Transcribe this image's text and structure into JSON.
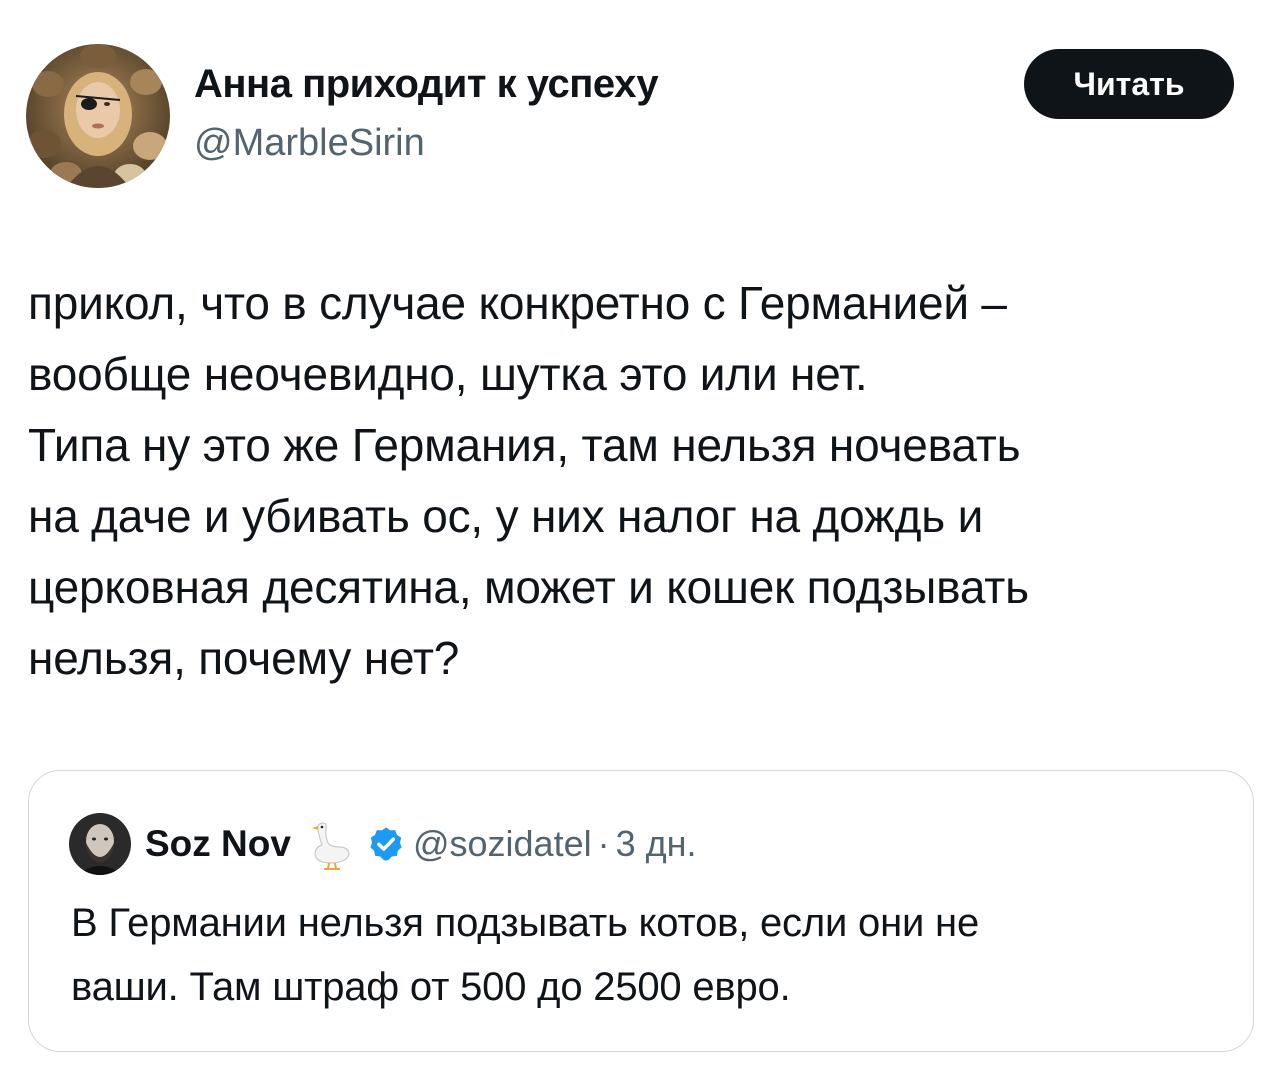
{
  "author": {
    "name": "Анна приходит к успеху",
    "handle": "@MarbleSirin",
    "avatar_icon": "avatar-woman-with-cats"
  },
  "follow_button": {
    "label": "Читать",
    "background": "#0f1419",
    "text_color": "#ffffff"
  },
  "tweet": {
    "lines": [
      "прикол, что в случае конкретно с Германией –",
      "вообще неочевидно, шутка это или нет.",
      "Типа ну это же Германия, там нельзя ночевать",
      "на даче и убивать ос, у них налог на дождь и",
      "церковная десятина, может и кошек подзывать",
      "нельзя, почему нет?"
    ]
  },
  "quote": {
    "name": "Soz Nov",
    "name_emoji_icon": "goose-icon",
    "verified_icon": "verified-badge-icon",
    "verified_color": "#1d9bf0",
    "handle": "@sozidatel",
    "separator": "·",
    "time": "3 дн.",
    "lines": [
      "В Германии нельзя подзывать котов, если они не",
      "ваши. Там штраф от 500 до 2500 евро."
    ]
  },
  "colors": {
    "text_primary": "#0f1419",
    "text_secondary": "#536471",
    "border": "#cfd9de"
  }
}
